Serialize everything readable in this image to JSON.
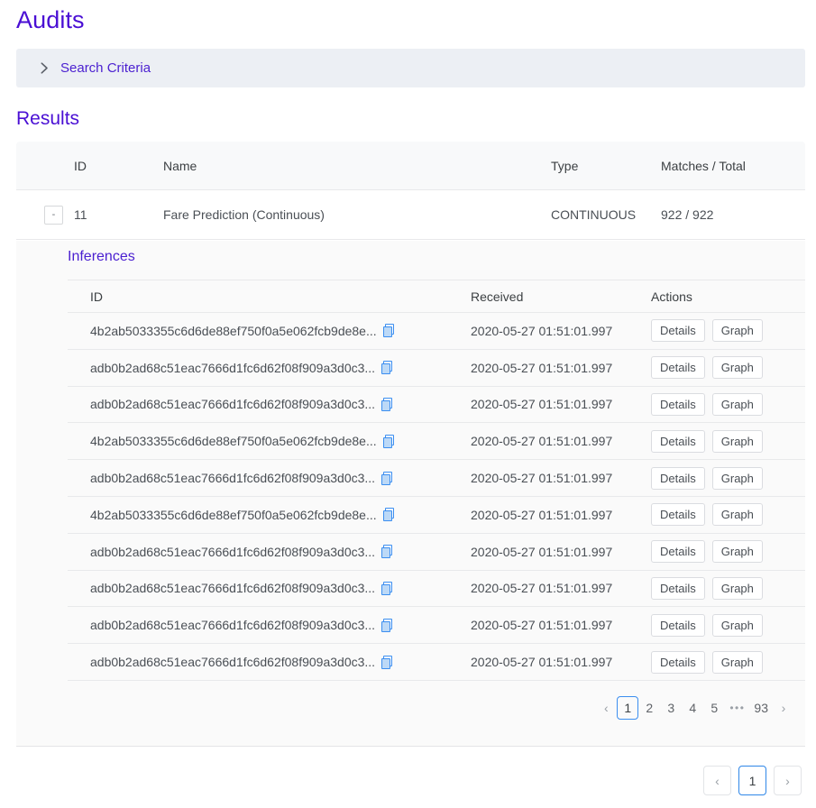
{
  "page": {
    "title": "Audits",
    "results_heading": "Results"
  },
  "search_criteria": {
    "label": "Search Criteria",
    "chevron": "chevron-right-icon",
    "expanded": false
  },
  "results_table": {
    "columns": [
      "",
      "ID",
      "Name",
      "Type",
      "Matches / Total"
    ],
    "rows": [
      {
        "expander": "-",
        "id": "11",
        "name": "Fare Prediction (Continuous)",
        "type": "CONTINUOUS",
        "matches_total": "922 / 922"
      }
    ]
  },
  "inferences": {
    "title": "Inferences",
    "columns": [
      "ID",
      "Received",
      "Actions"
    ],
    "copy_icon": "copy-icon",
    "details_label": "Details",
    "graph_label": "Graph",
    "rows": [
      {
        "id": "4b2ab5033355c6d6de88ef750f0a5e062fcb9de8e...",
        "received": "2020-05-27 01:51:01.997"
      },
      {
        "id": "adb0b2ad68c51eac7666d1fc6d62f08f909a3d0c3...",
        "received": "2020-05-27 01:51:01.997"
      },
      {
        "id": "adb0b2ad68c51eac7666d1fc6d62f08f909a3d0c3...",
        "received": "2020-05-27 01:51:01.997"
      },
      {
        "id": "4b2ab5033355c6d6de88ef750f0a5e062fcb9de8e...",
        "received": "2020-05-27 01:51:01.997"
      },
      {
        "id": "adb0b2ad68c51eac7666d1fc6d62f08f909a3d0c3...",
        "received": "2020-05-27 01:51:01.997"
      },
      {
        "id": "4b2ab5033355c6d6de88ef750f0a5e062fcb9de8e...",
        "received": "2020-05-27 01:51:01.997"
      },
      {
        "id": "adb0b2ad68c51eac7666d1fc6d62f08f909a3d0c3...",
        "received": "2020-05-27 01:51:01.997"
      },
      {
        "id": "adb0b2ad68c51eac7666d1fc6d62f08f909a3d0c3...",
        "received": "2020-05-27 01:51:01.997"
      },
      {
        "id": "adb0b2ad68c51eac7666d1fc6d62f08f909a3d0c3...",
        "received": "2020-05-27 01:51:01.997"
      },
      {
        "id": "adb0b2ad68c51eac7666d1fc6d62f08f909a3d0c3...",
        "received": "2020-05-27 01:51:01.997"
      }
    ],
    "pagination": {
      "prev": "‹",
      "next": "›",
      "pages": [
        "1",
        "2",
        "3",
        "4",
        "5"
      ],
      "ellipsis": "•••",
      "last": "93",
      "current": "1"
    }
  },
  "results_pagination": {
    "prev": "‹",
    "next": "›",
    "pages": [
      "1"
    ],
    "current": "1"
  },
  "colors": {
    "brand_purple": "#4a0fd4",
    "link_purple": "#4a1fd0",
    "accent_blue": "#3b8ef0",
    "accordion_bg": "#eceff4",
    "panel_bg": "#fafafa",
    "header_bg": "#f8f9fa",
    "border": "#e8e9eb",
    "text": "#4a4f55"
  }
}
